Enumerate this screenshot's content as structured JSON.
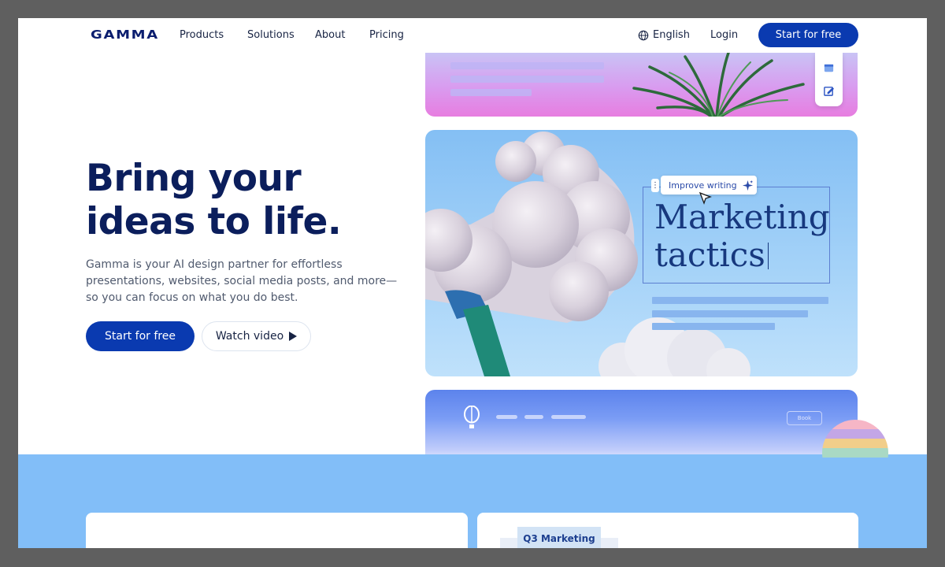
{
  "nav": {
    "logo": "GAMMA",
    "links": [
      "Products",
      "Solutions",
      "About",
      "Pricing"
    ],
    "language": "English",
    "login": "Login",
    "cta": "Start for free"
  },
  "hero": {
    "title_line1": "Bring your",
    "title_line2": "ideas to life.",
    "subtitle": "Gamma is your AI design partner for effortless presentations, websites, social media posts, and more—so you can focus on what you do best.",
    "primary_button": "Start for free",
    "secondary_button": "Watch video"
  },
  "preview": {
    "improve_label": "Improve writing",
    "heading_line1": "Marketing",
    "heading_line2": "tactics",
    "book_label": "Book"
  },
  "bottom": {
    "card_heading": "Q3 Marketing"
  },
  "colors": {
    "brand_navy": "#0b1e5c",
    "cta_blue": "#0a3ab0",
    "band_blue": "#82bef8"
  },
  "icons": [
    "globe-icon",
    "play-icon",
    "card-icon",
    "edit-icon",
    "sparkle-icon",
    "cursor-icon",
    "balloon-icon"
  ]
}
